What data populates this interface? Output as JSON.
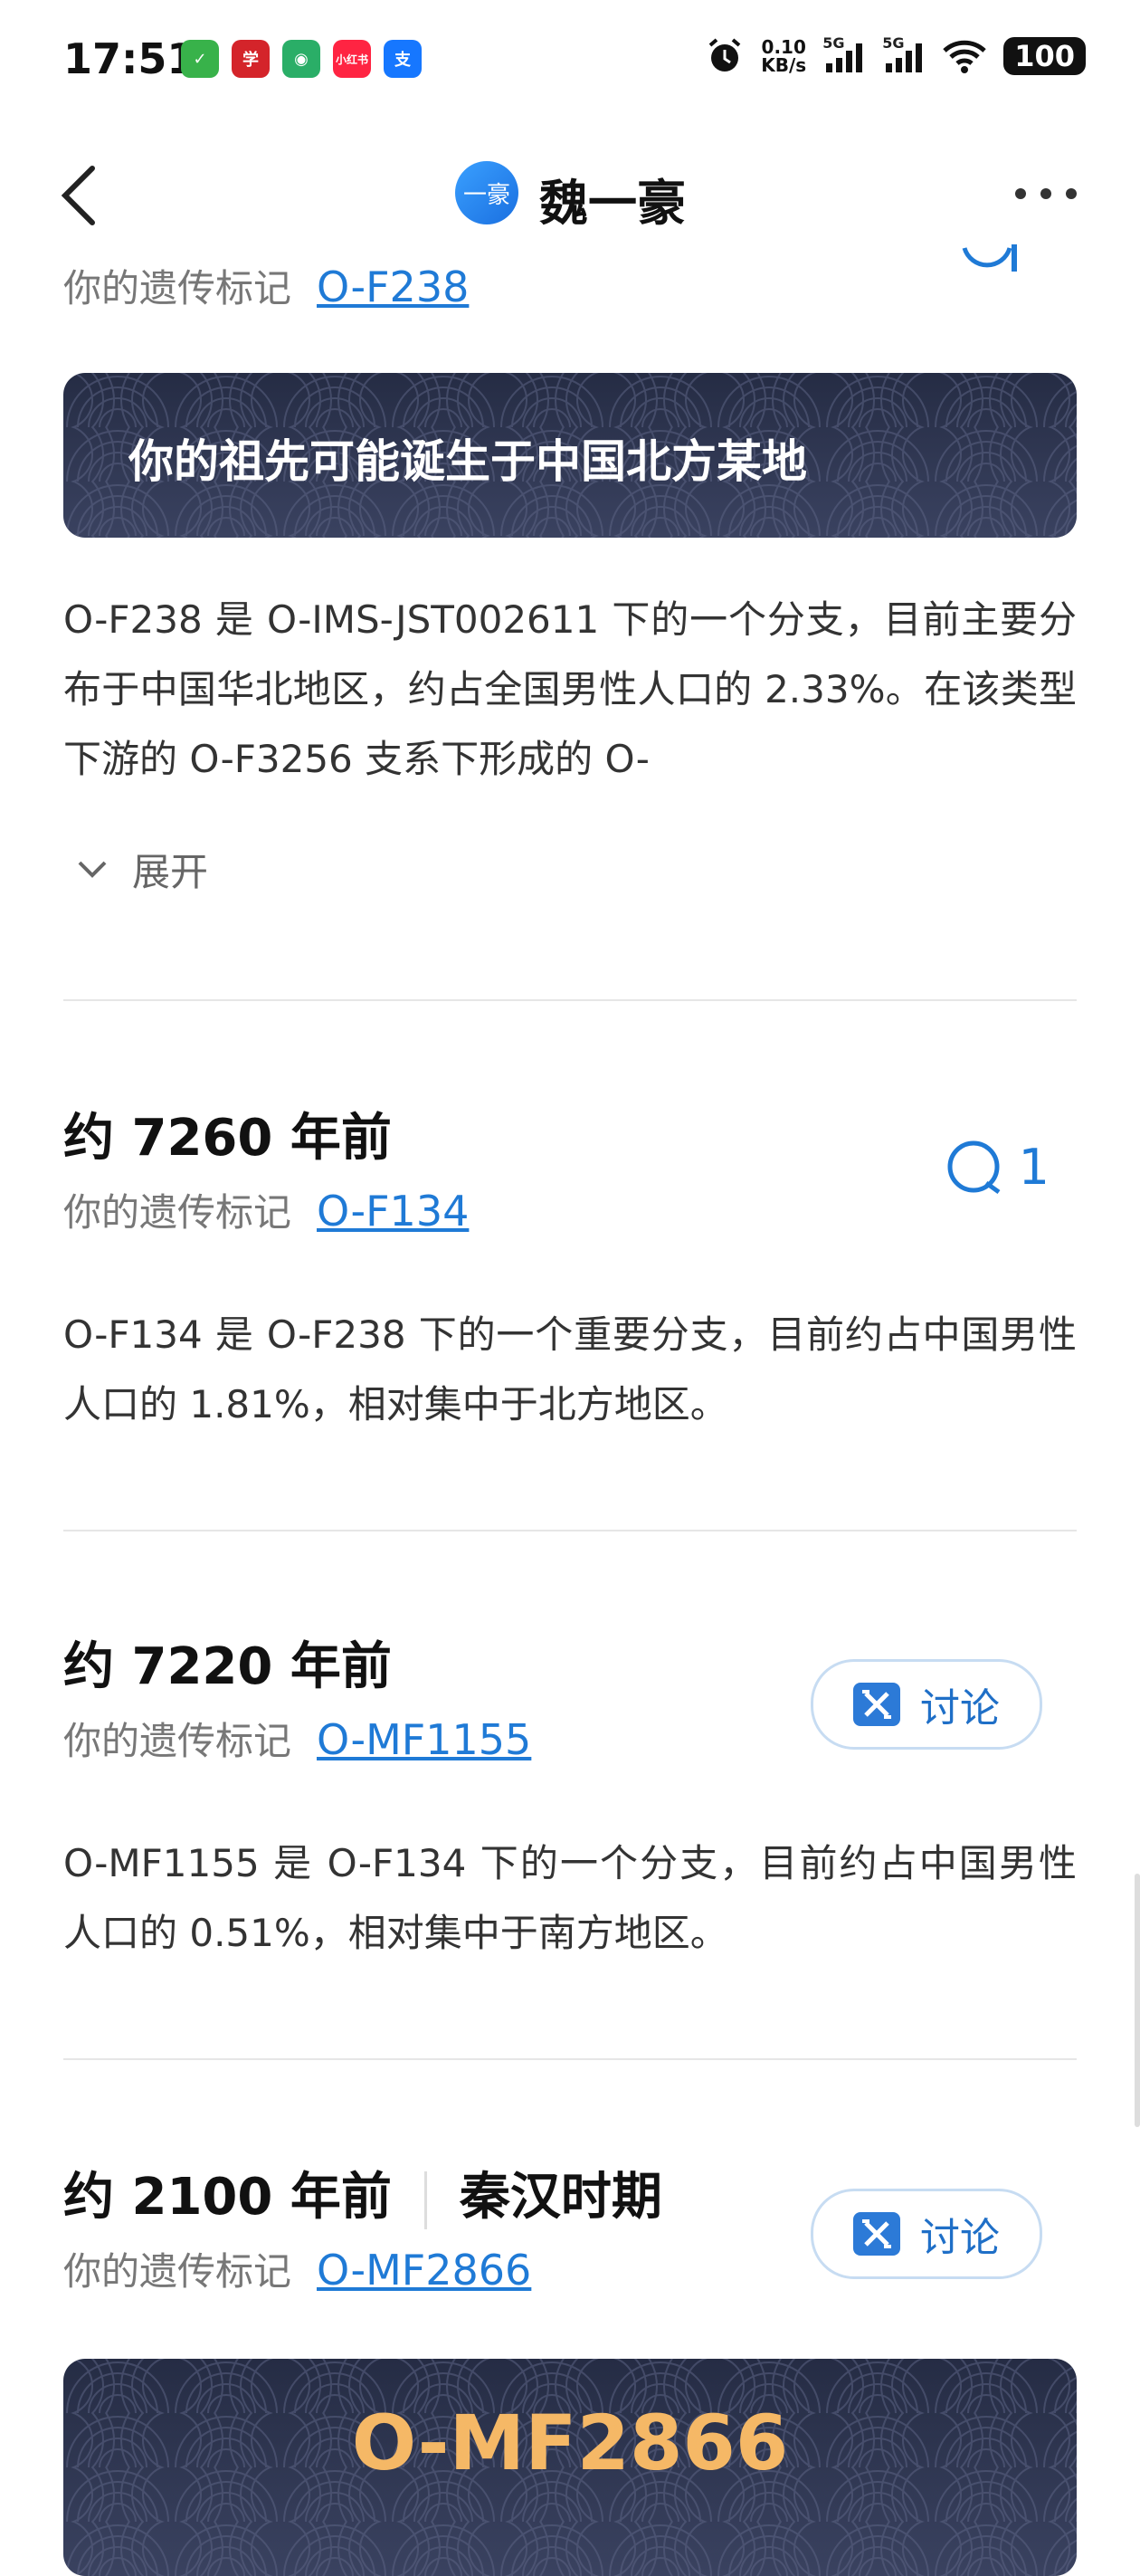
{
  "status": {
    "time": "17:51",
    "net_speed": "0.10",
    "net_unit": "KB/s",
    "signal1": "5G",
    "signal2": "5G",
    "battery": "100",
    "app_icons": [
      {
        "name": "notes-app-icon",
        "glyph": "✓",
        "color": "#38b24a"
      },
      {
        "name": "xuexi-app-icon",
        "glyph": "学",
        "color": "#d4242a"
      },
      {
        "name": "wechat-app-icon",
        "glyph": "◉",
        "color": "#2aae67"
      },
      {
        "name": "xiaohongshu-app-icon",
        "glyph": "小红书",
        "color": "#ff2442"
      },
      {
        "name": "alipay-app-icon",
        "glyph": "支",
        "color": "#1677ff"
      }
    ]
  },
  "nav": {
    "avatar_text": "一豪",
    "title": "魏一豪"
  },
  "label": "你的遗传标记",
  "section0": {
    "marker": "O-F238",
    "banner": "你的祖先可能诞生于中国北方某地",
    "text": "O-F238 是 O-IMS-JST002611 下的一个分支，目前主要分布于中国华北地区，约占全国男性人口的 2.33%。在该类型下游的 O-F3256 支系下形成的 O-",
    "expand": "展开"
  },
  "section1": {
    "era": "约 7260 年前",
    "marker": "O-F134",
    "comment_count": "1",
    "text": "O-F134 是 O-F238 下的一个重要分支，目前约占中国男性人口的 1.81%，相对集中于北方地区。"
  },
  "section2": {
    "era": "约 7220 年前",
    "marker": "O-MF1155",
    "discuss": "讨论",
    "text": "O-MF1155 是 O-F134 下的一个分支，目前约占中国男性人口的 0.51%，相对集中于南方地区。"
  },
  "section3": {
    "era": "约 2100 年前",
    "period": "秦汉时期",
    "marker": "O-MF2866",
    "discuss": "讨论",
    "banner": "O-MF2866"
  },
  "colors": {
    "accent": "#1f7ad6",
    "banner_bg": "#2b3250",
    "banner_gold": "#f5b866"
  }
}
